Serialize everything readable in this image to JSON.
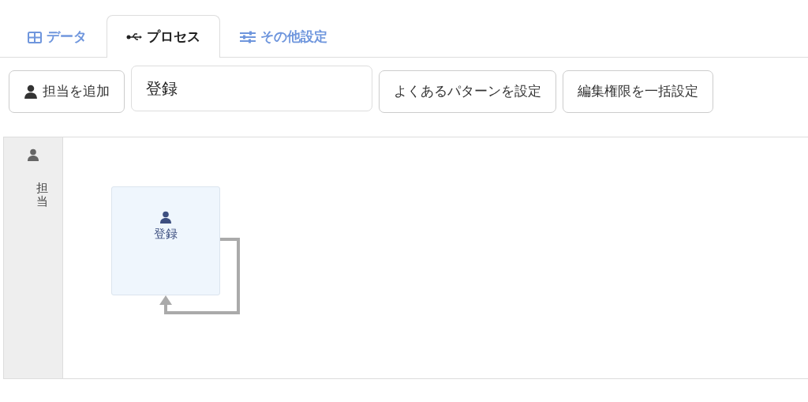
{
  "tabs": [
    {
      "label": "データ",
      "selected": false
    },
    {
      "label": "プロセス",
      "selected": true
    },
    {
      "label": "その他設定",
      "selected": false
    }
  ],
  "toolbar": {
    "add_button": "担当を追加",
    "name_field": {
      "value": "登録"
    },
    "buttons": [
      "よくあるパターンを設定",
      "編集権限を一括設定"
    ]
  },
  "lanes": [
    {
      "label": "担当",
      "nodes": [
        {
          "label": "登録"
        }
      ]
    }
  ]
}
